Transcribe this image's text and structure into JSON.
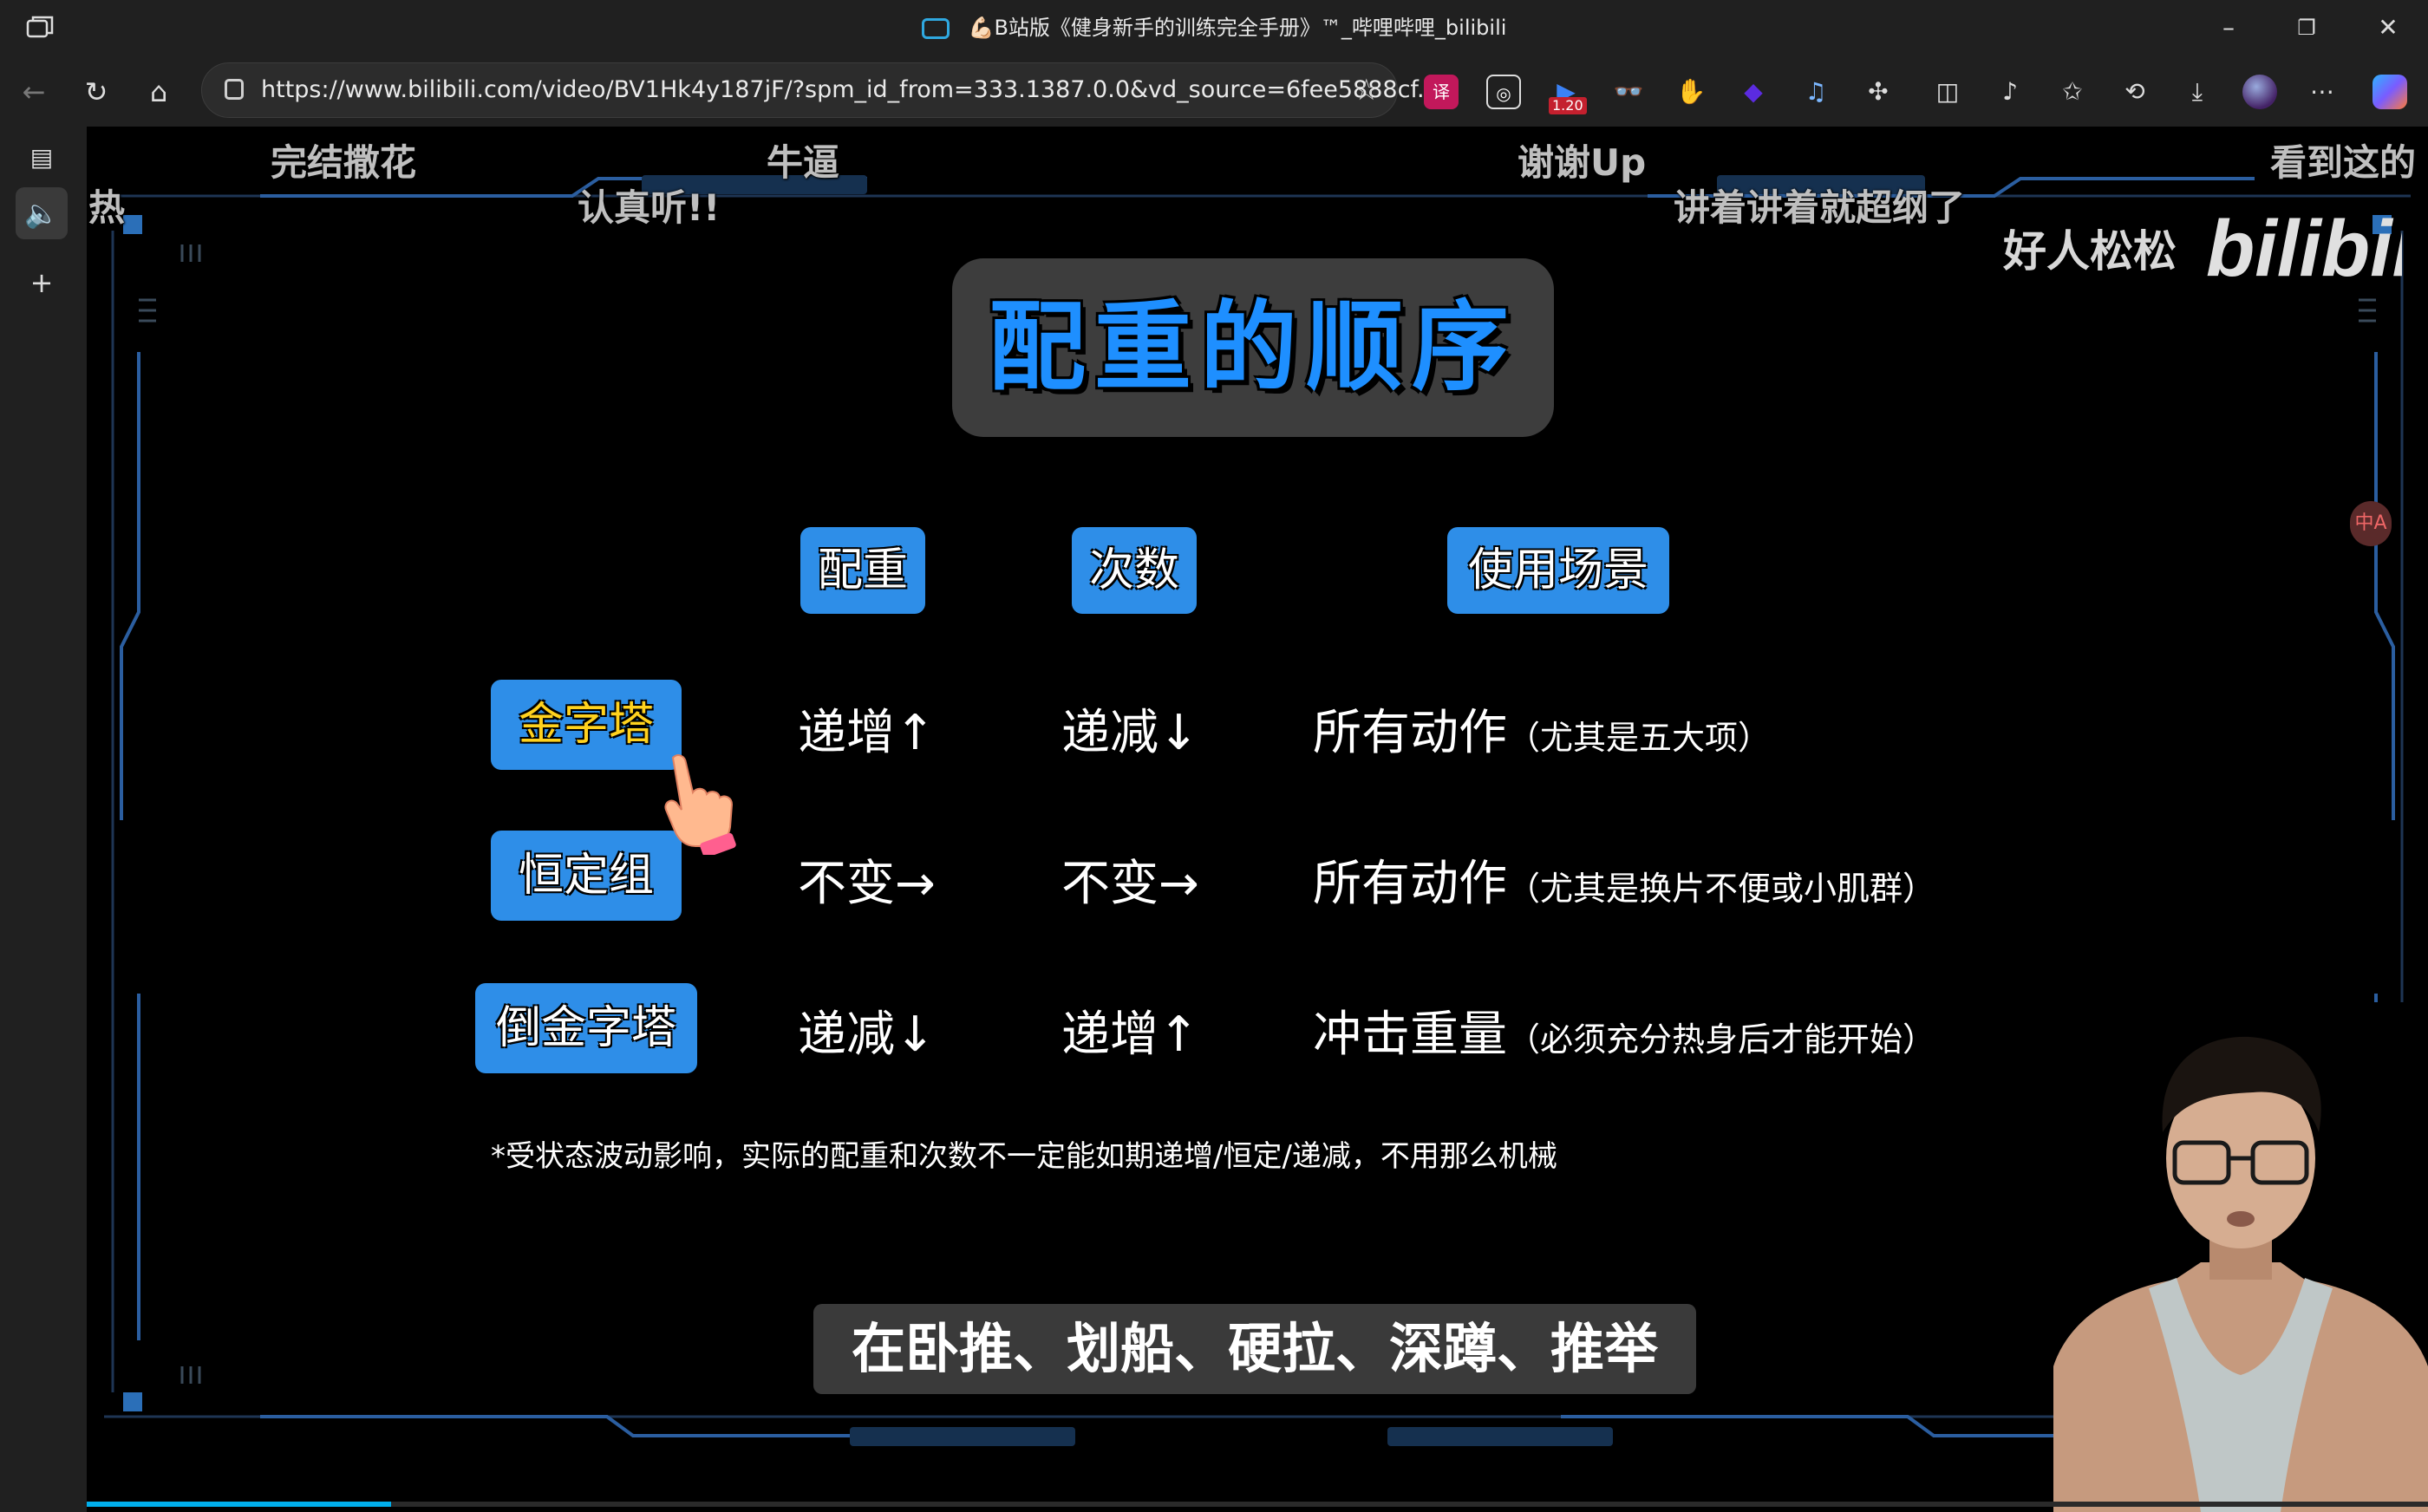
{
  "browser": {
    "window_title": "💪🏻B站版《健身新手的训练完全手册》™_哔哩哔哩_bilibili",
    "url": "https://www.bilibili.com/video/BV1Hk4y187jF/?spm_id_from=333.1387.0.0&vd_source=6fee5888cf...",
    "extension_badge": "1.20",
    "accent": "#00aeec"
  },
  "video": {
    "danmaku": [
      {
        "text": "完结撒花"
      },
      {
        "text": "牛逼"
      },
      {
        "text": "谢谢Up"
      },
      {
        "text": "看到这的"
      },
      {
        "text": "热"
      },
      {
        "text": "认真听!!"
      },
      {
        "text": "讲着讲着就超纲了"
      }
    ],
    "watermark_text": "好人松松",
    "watermark_logo": "bilibili",
    "slide": {
      "title": "配重的顺序",
      "headers": [
        "配重",
        "次数",
        "使用场景"
      ],
      "rows": [
        {
          "label": "金字塔",
          "weight": "递增↑",
          "reps": "递减↓",
          "scene": "所有动作",
          "scene_note": "（尤其是五大项）"
        },
        {
          "label": "恒定组",
          "weight": "不变→",
          "reps": "不变→",
          "scene": "所有动作",
          "scene_note": "（尤其是换片不便或小肌群）"
        },
        {
          "label": "倒金字塔",
          "weight": "递减↓",
          "reps": "递增↑",
          "scene": "冲击重量",
          "scene_note": "（必须充分热身后才能开始）"
        }
      ],
      "footnote": "*受状态波动影响，实际的配重和次数不一定能如期递增/恒定/递减，不用那么机械"
    },
    "subtitle": "在卧推、划船、硬拉、深蹲、推举",
    "translate_button": "中A",
    "progress": 0.13
  }
}
